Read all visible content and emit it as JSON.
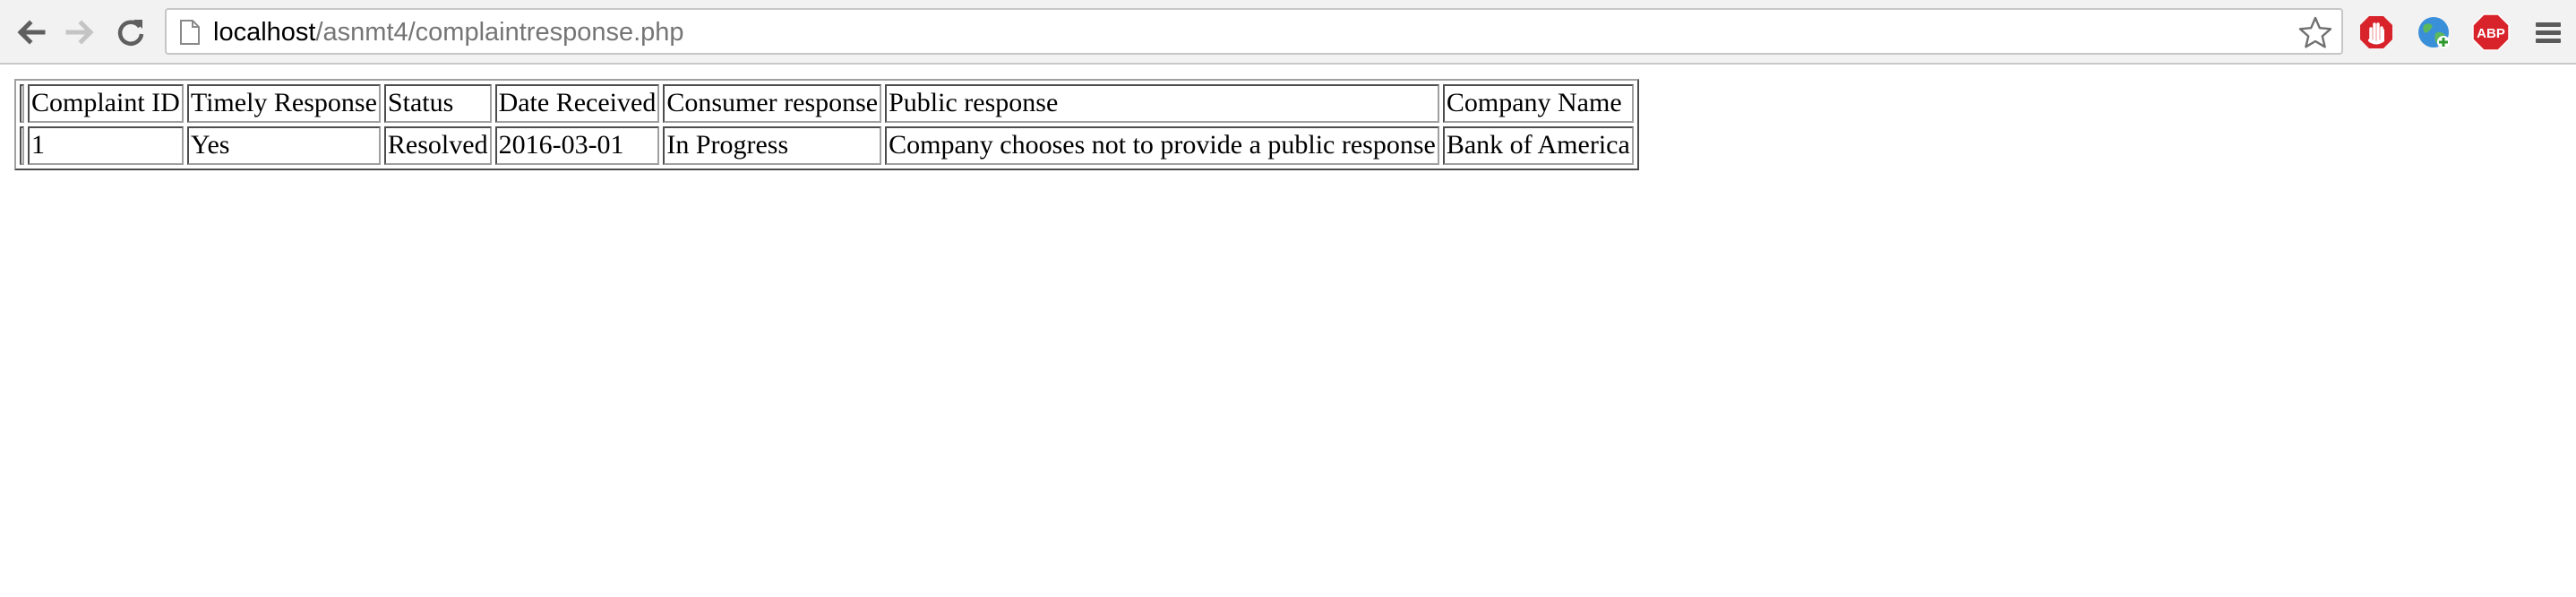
{
  "browser": {
    "url_host": "localhost",
    "url_path": "/asnmt4/complaintresponse.php",
    "icons": {
      "back": "arrow-left",
      "forward": "arrow-right",
      "reload": "circular-arrow",
      "page": "document",
      "bookmark": "star",
      "extensions": [
        "red-hand-stop",
        "globe-green",
        "adblock-plus-octagon"
      ],
      "menu": "hamburger"
    },
    "adblock_label": "ABP"
  },
  "table": {
    "headers": [
      "Complaint ID",
      "Timely Response",
      "Status",
      "Date Received",
      "Consumer response",
      "Public response",
      "Company Name"
    ],
    "rows": [
      [
        "1",
        "Yes",
        "Resolved",
        "2016-03-01",
        "In Progress",
        "Company chooses not to provide a public response",
        "Bank of America"
      ]
    ]
  }
}
